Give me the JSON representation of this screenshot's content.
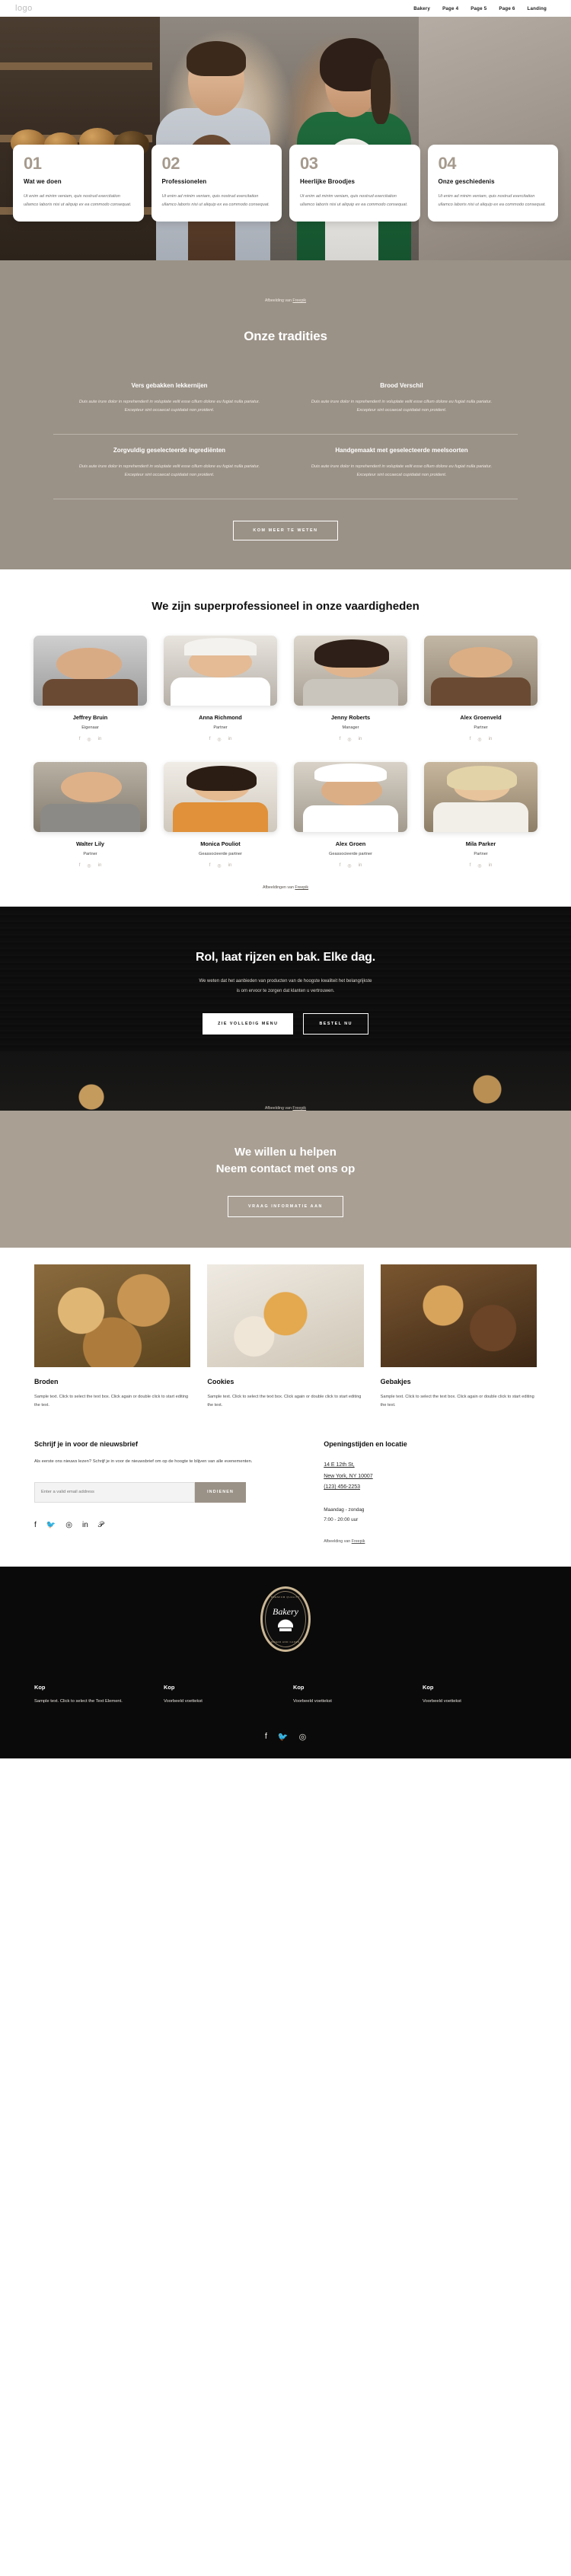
{
  "header": {
    "logo": "logo",
    "nav": [
      "Bakery",
      "Page 4",
      "Page 5",
      "Page 6",
      "Landing"
    ]
  },
  "feature_cards": [
    {
      "num": "01",
      "title": "Wat we doen",
      "text": "Ut enim ad minim veniam, quis nostrud exercitation ullamco laboris nisi ut aliquip ex ea commodo consequat."
    },
    {
      "num": "02",
      "title": "Professionelen",
      "text": "Ut enim ad minim veniam, quis nostrud exercitation ullamco laboris nisi ut aliquip ex ea commodo consequat."
    },
    {
      "num": "03",
      "title": "Heerlijke Broodjes",
      "text": "Ut enim ad minim veniam, quis nostrud exercitation ullamco laboris nisi ut aliquip ex ea commodo consequat."
    },
    {
      "num": "04",
      "title": "Onze geschiedenis",
      "text": "Ut enim ad minim veniam, quis nostrud exercitation ullamco laboris nisi ut aliquip ex ea commodo consequat."
    }
  ],
  "hero_credit": {
    "prefix": "Afbeelding van ",
    "link": "Freepik"
  },
  "traditions": {
    "heading": "Onze tradities",
    "items": [
      {
        "title": "Vers gebakken lekkernijen",
        "text": "Duis aute irure dolor in reprehenderit in voluptate velit esse cillum dolore eu fugiat nulla pariatur. Excepteur sint occaecat cupidatat non proident."
      },
      {
        "title": "Brood Verschil",
        "text": "Duis aute irure dolor in reprehenderit in voluptate velit esse cillum dolore eu fugiat nulla pariatur. Excepteur sint occaecat cupidatat non proident."
      },
      {
        "title": "Zorgvuldig geselecteerde ingrediënten",
        "text": "Duis aute irure dolor in reprehenderit in voluptate velit esse cillum dolore eu fugiat nulla pariatur. Excepteur sint occaecat cupidatat non proident."
      },
      {
        "title": "Handgemaakt met geselecteerde meelsoorten",
        "text": "Duis aute irure dolor in reprehenderit in voluptate velit esse cillum dolore eu fugiat nulla pariatur. Excepteur sint occaecat cupidatat non proident."
      }
    ],
    "button": "KOM MEER TE WETEN"
  },
  "team": {
    "heading": "We zijn superprofessioneel in onze vaardigheden",
    "members": [
      {
        "name": "Jeffrey Bruin",
        "role": "Eigenaar"
      },
      {
        "name": "Anna Richmond",
        "role": "Partner"
      },
      {
        "name": "Jenny Roberts",
        "role": "Manager"
      },
      {
        "name": "Alex Groenveld",
        "role": "Partner"
      },
      {
        "name": "Walter Lily",
        "role": "Partner"
      },
      {
        "name": "Monica Pouliot",
        "role": "Geassocieerde partner"
      },
      {
        "name": "Alex Groen",
        "role": "Geassocieerde partner"
      },
      {
        "name": "Mila Parker",
        "role": "Partner"
      }
    ],
    "social": [
      "f",
      "◎",
      "in"
    ],
    "credit": {
      "prefix": "Afbeeldingen van ",
      "link": "Freepik"
    }
  },
  "cta": {
    "heading": "Rol, laat rijzen en bak. Elke dag.",
    "line1": "We weten dat het aanbieden van producten van de hoogste kwaliteit het belangrijkste",
    "line2": "is om ervoor te zorgen dat klanten u vertrouwen.",
    "primary_button": "ZIE VOLLEDIG MENU",
    "secondary_button": "BESTEL NU",
    "credit": {
      "prefix": "Afbeelding van ",
      "link": "Freepik"
    }
  },
  "contact": {
    "line1": "We willen u helpen",
    "line2": "Neem contact met ons op",
    "button": "VRAAG INFORMATIE AAN"
  },
  "products": [
    {
      "title": "Broden",
      "text": "Sample text. Click to select the text box. Click again or double click to start editing the text."
    },
    {
      "title": "Cookies",
      "text": "Sample text. Click to select the text box. Click again or double click to start editing the text."
    },
    {
      "title": "Gebakjes",
      "text": "Sample text. Click to select the text box. Click again or double click to start editing the text."
    }
  ],
  "newsletter": {
    "heading": "Schrijf je in voor de nieuwsbrief",
    "text": "Als eerste ons nieuws lezen? Schrijf je in voor de nieuwsbrief om op de hoogte te blijven van alle evenementen.",
    "input_placeholder": "Enter a valid email address",
    "submit": "INDIENEN",
    "social": [
      "f",
      "🐦",
      "◎",
      "in",
      "𝒫"
    ]
  },
  "hours": {
    "heading": "Openingstijden en locatie",
    "address_line1": "14 E 12th St,",
    "address_line2": "New York, NY 10007",
    "phone": "(123) 456-2253",
    "days": "Maandag - zondag",
    "time": "7:00 - 20:00 uur",
    "credit": {
      "prefix": "Afbeelding van ",
      "link": "Freepik"
    }
  },
  "footer": {
    "badge_top": "PREMIUM QUALITY",
    "badge_name": "Bakery",
    "badge_bottom": "BREAD AND CAKES",
    "columns": [
      {
        "heading": "Kop",
        "text": "Sample text. Click to select the Text Element."
      },
      {
        "heading": "Kop",
        "text": "Voorbeeld voettekst"
      },
      {
        "heading": "Kop",
        "text": "Voorbeeld voettekst"
      },
      {
        "heading": "Kop",
        "text": "Voorbeeld voettekst"
      }
    ],
    "social": [
      "f",
      "🐦",
      "◎"
    ]
  },
  "colors": {
    "tan": "#9b9287",
    "tan_light": "#a99f93",
    "dark": "#0d0d0d",
    "gold": "#cbb795"
  }
}
